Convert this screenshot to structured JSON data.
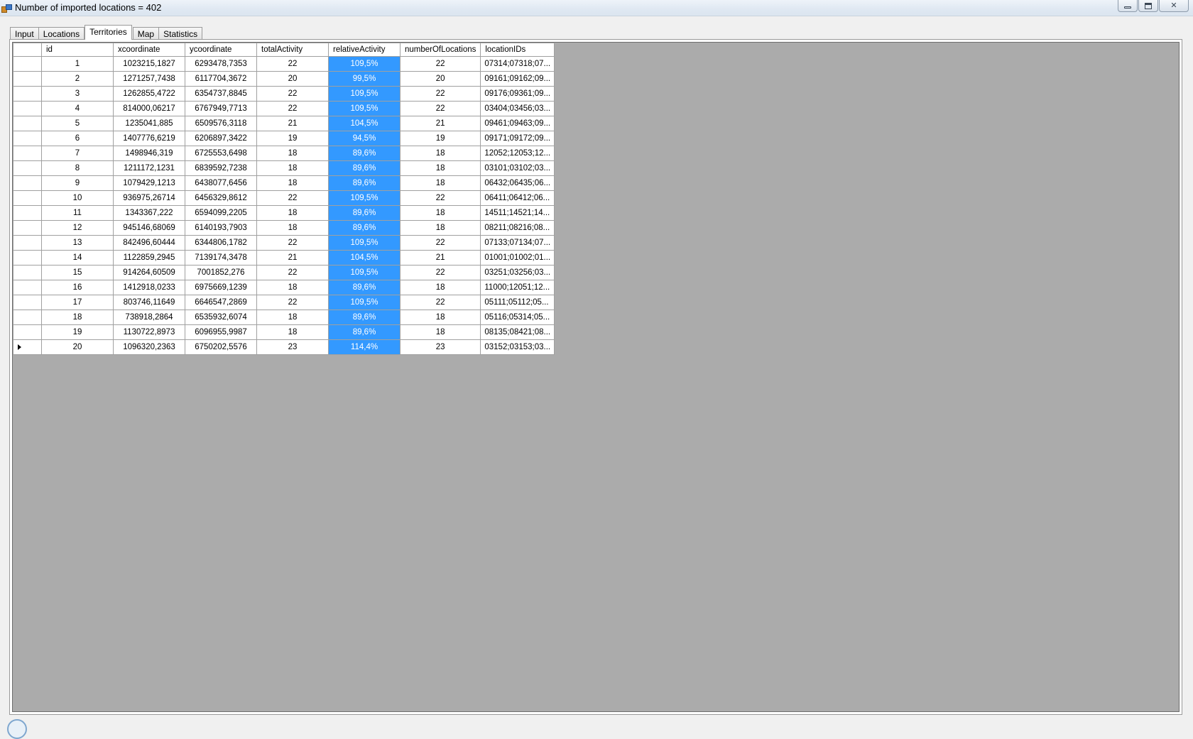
{
  "window": {
    "title": "Number of imported locations = 402",
    "icon": "app-window-icon",
    "controls": [
      "minimize-icon",
      "maximize-icon",
      "close-icon"
    ],
    "close_glyph": "✕"
  },
  "tabs": [
    {
      "label": "Input",
      "active": false
    },
    {
      "label": "Locations",
      "active": false
    },
    {
      "label": "Territories",
      "active": true
    },
    {
      "label": "Map",
      "active": false
    },
    {
      "label": "Statistics",
      "active": false
    }
  ],
  "grid": {
    "columns": [
      "id",
      "xcoordinate",
      "ycoordinate",
      "totalActivity",
      "relativeActivity",
      "numberOfLocations",
      "locationIDs"
    ],
    "highlight_color": "#3399ff",
    "current_row_index": 19,
    "rows": [
      [
        "1",
        "1023215,1827",
        "6293478,7353",
        "22",
        "109,5%",
        "22",
        "07314;07318;07..."
      ],
      [
        "2",
        "1271257,7438",
        "6117704,3672",
        "20",
        "99,5%",
        "20",
        "09161;09162;09..."
      ],
      [
        "3",
        "1262855,4722",
        "6354737,8845",
        "22",
        "109,5%",
        "22",
        "09176;09361;09..."
      ],
      [
        "4",
        "814000,06217",
        "6767949,7713",
        "22",
        "109,5%",
        "22",
        "03404;03456;03..."
      ],
      [
        "5",
        "1235041,885",
        "6509576,3118",
        "21",
        "104,5%",
        "21",
        "09461;09463;09..."
      ],
      [
        "6",
        "1407776,6219",
        "6206897,3422",
        "19",
        "94,5%",
        "19",
        "09171;09172;09..."
      ],
      [
        "7",
        "1498946,319",
        "6725553,6498",
        "18",
        "89,6%",
        "18",
        "12052;12053;12..."
      ],
      [
        "8",
        "1211172,1231",
        "6839592,7238",
        "18",
        "89,6%",
        "18",
        "03101;03102;03..."
      ],
      [
        "9",
        "1079429,1213",
        "6438077,6456",
        "18",
        "89,6%",
        "18",
        "06432;06435;06..."
      ],
      [
        "10",
        "936975,26714",
        "6456329,8612",
        "22",
        "109,5%",
        "22",
        "06411;06412;06..."
      ],
      [
        "11",
        "1343367,222",
        "6594099,2205",
        "18",
        "89,6%",
        "18",
        "14511;14521;14..."
      ],
      [
        "12",
        "945146,68069",
        "6140193,7903",
        "18",
        "89,6%",
        "18",
        "08211;08216;08..."
      ],
      [
        "13",
        "842496,60444",
        "6344806,1782",
        "22",
        "109,5%",
        "22",
        "07133;07134;07..."
      ],
      [
        "14",
        "1122859,2945",
        "7139174,3478",
        "21",
        "104,5%",
        "21",
        "01001;01002;01..."
      ],
      [
        "15",
        "914264,60509",
        "7001852,276",
        "22",
        "109,5%",
        "22",
        "03251;03256;03..."
      ],
      [
        "16",
        "1412918,0233",
        "6975669,1239",
        "18",
        "89,6%",
        "18",
        "11000;12051;12..."
      ],
      [
        "17",
        "803746,11649",
        "6646547,2869",
        "22",
        "109,5%",
        "22",
        "05111;05112;05..."
      ],
      [
        "18",
        "738918,2864",
        "6535932,6074",
        "18",
        "89,6%",
        "18",
        "05116;05314;05..."
      ],
      [
        "19",
        "1130722,8973",
        "6096955,9987",
        "18",
        "89,6%",
        "18",
        "08135;08421;08..."
      ],
      [
        "20",
        "1096320,2363",
        "6750202,5576",
        "23",
        "114,4%",
        "23",
        "03152;03153;03..."
      ]
    ]
  }
}
